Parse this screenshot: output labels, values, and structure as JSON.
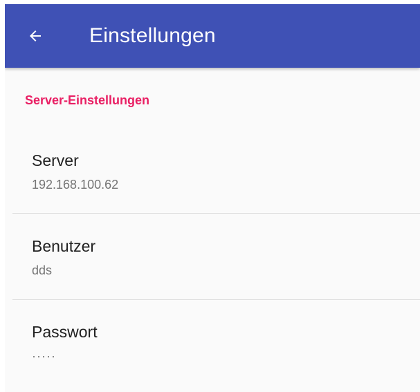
{
  "appbar": {
    "title": "Einstellungen",
    "back_icon": "arrow-back-icon",
    "color": "#3f51b5",
    "text_color": "#ffffff"
  },
  "category": {
    "title": "Server-Einstellungen",
    "color": "#e91e63"
  },
  "preferences": [
    {
      "label": "Server",
      "summary": "192.168.100.62"
    },
    {
      "label": "Benutzer",
      "summary": "dds"
    },
    {
      "label": "Passwort",
      "summary": "·····"
    }
  ]
}
